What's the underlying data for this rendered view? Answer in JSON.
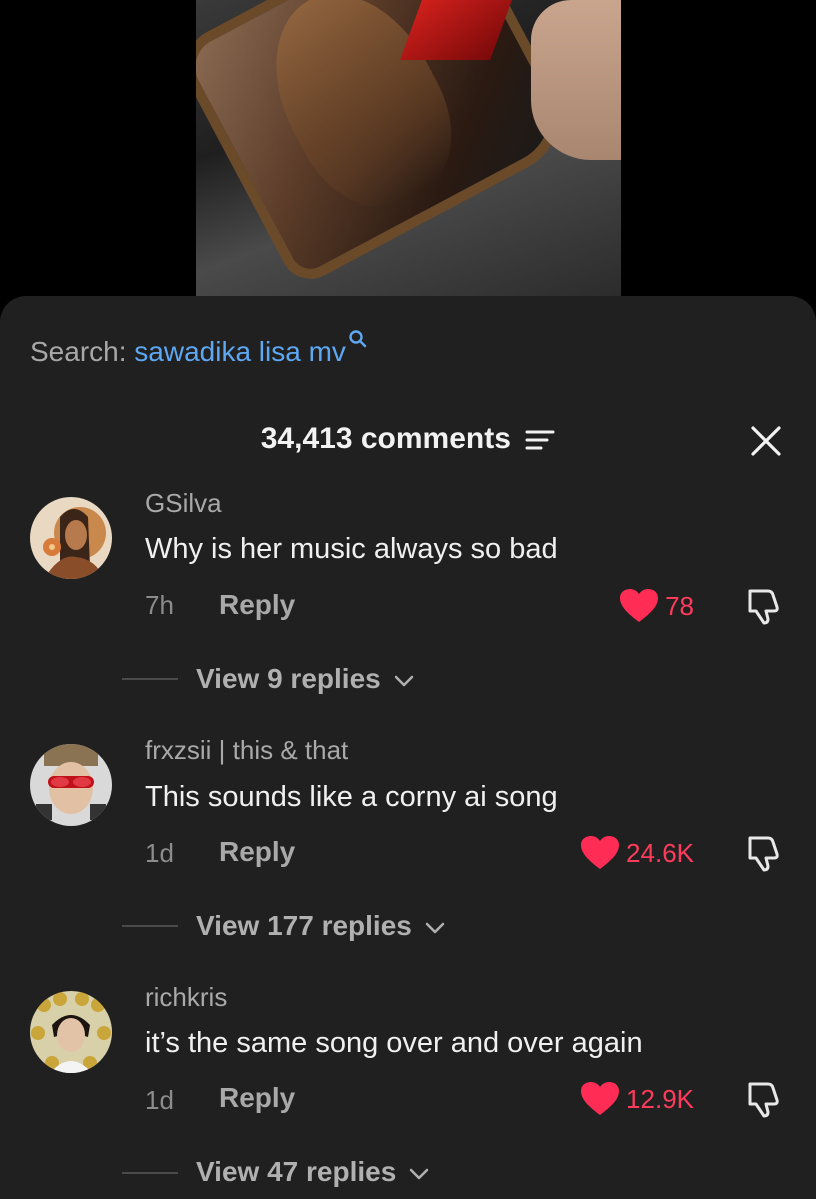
{
  "video": {
    "thumbnail_icon": "music-video-thumbnail"
  },
  "search": {
    "label": "Search:",
    "query": "sawadika lisa mv",
    "icon": "search-icon"
  },
  "header": {
    "title": "34,413 comments",
    "filter_icon": "filter-icon",
    "close_icon": "close-icon"
  },
  "comments": [
    {
      "username": "GSilva",
      "text": "Why is her music always so bad",
      "time": "7h",
      "reply_label": "Reply",
      "likes": "78",
      "view_replies": "View 9 replies"
    },
    {
      "username": "frxzsii | this & that",
      "text": "This sounds like a corny ai song",
      "time": "1d",
      "reply_label": "Reply",
      "likes": "24.6K",
      "view_replies": "View 177 replies"
    },
    {
      "username": "richkris",
      "text": "it’s the same song over and over again",
      "time": "1d",
      "reply_label": "Reply",
      "likes": "12.9K",
      "view_replies": "View 47 replies"
    }
  ],
  "colors": {
    "sheet_bg": "#202020",
    "accent_blue": "#5ea7f2",
    "like_red": "#ff3b5c"
  }
}
